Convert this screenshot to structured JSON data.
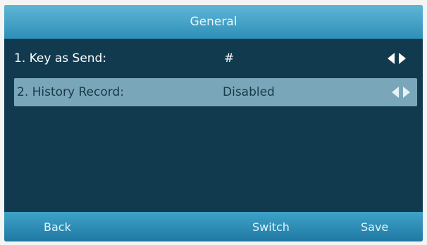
{
  "title": "General",
  "rows": [
    {
      "label": "1. Key as Send:",
      "value": "#"
    },
    {
      "label": "2. History Record:",
      "value": "Disabled"
    }
  ],
  "softkeys": {
    "back": "Back",
    "switch": "Switch",
    "save": "Save"
  },
  "colors": {
    "screen_bg": "#123a4f",
    "title_bar": "#3f9fc6",
    "selected_row": "#7aa6b9",
    "softkey_bar": "#2a8cb6"
  }
}
